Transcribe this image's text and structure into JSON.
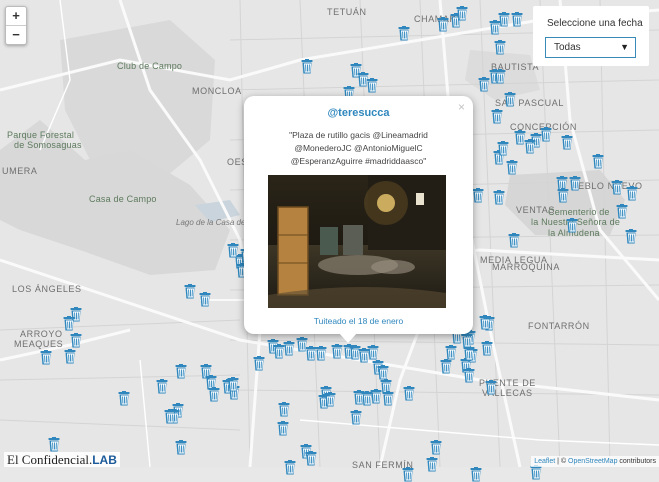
{
  "map": {
    "places": [
      {
        "text": "TETUÁN",
        "cls": ""
      },
      {
        "text": "CHAMART",
        "cls": ""
      },
      {
        "text": "Club de Campo",
        "cls": "green"
      },
      {
        "text": "MONCLOA",
        "cls": ""
      },
      {
        "text": "Parque Forestal",
        "cls": "green"
      },
      {
        "text": "de Somosaguas",
        "cls": "green"
      },
      {
        "text": "UMERA",
        "cls": ""
      },
      {
        "text": "Casa de Campo",
        "cls": "green"
      },
      {
        "text": "Lago de la Casa de Campo",
        "cls": "italic"
      },
      {
        "text": "LOS ÁNGELES",
        "cls": ""
      },
      {
        "text": "ARROYO",
        "cls": ""
      },
      {
        "text": "MEAQUES",
        "cls": ""
      },
      {
        "text": "BAUTISTA",
        "cls": ""
      },
      {
        "text": "SAN PASCUAL",
        "cls": ""
      },
      {
        "text": "CONCEPCIÓN",
        "cls": ""
      },
      {
        "text": "UEBLO NUEVO",
        "cls": ""
      },
      {
        "text": "VENTAS",
        "cls": ""
      },
      {
        "text": "Cementerio de",
        "cls": "green"
      },
      {
        "text": "la Nuestra Señora de",
        "cls": "green"
      },
      {
        "text": "la Almudena",
        "cls": "green"
      },
      {
        "text": "MEDIA LEGUA",
        "cls": ""
      },
      {
        "text": "MARROQUINA",
        "cls": ""
      },
      {
        "text": "FONTARRÓN",
        "cls": ""
      },
      {
        "text": "PUENTE DE",
        "cls": ""
      },
      {
        "text": "VALLECAS",
        "cls": ""
      },
      {
        "text": "SAN FERMÍN",
        "cls": ""
      },
      {
        "text": "OES",
        "cls": ""
      }
    ],
    "bin_count": 110,
    "accent": "#2f87bd"
  },
  "zoom": {
    "in_label": "+",
    "out_label": "−"
  },
  "filter": {
    "label": "Seleccione una fecha",
    "selected": "Todas",
    "arrow": "▼"
  },
  "popup": {
    "user": "@teresucca",
    "text": "\"Plaza de rutillo gacis @Lineamadrid @MonederoJC @AntonioMiguelC @EsperanzAguirre #madriddaasco\"",
    "date_link": "Tuiteado el 18 de enero",
    "close": "×"
  },
  "brand": {
    "name": "El Confidencial.",
    "lab": "LAB"
  },
  "attribution": {
    "leaflet": "Leaflet",
    "sep": " | © ",
    "osm": "OpenStreetMap",
    "tail": " contributors"
  }
}
